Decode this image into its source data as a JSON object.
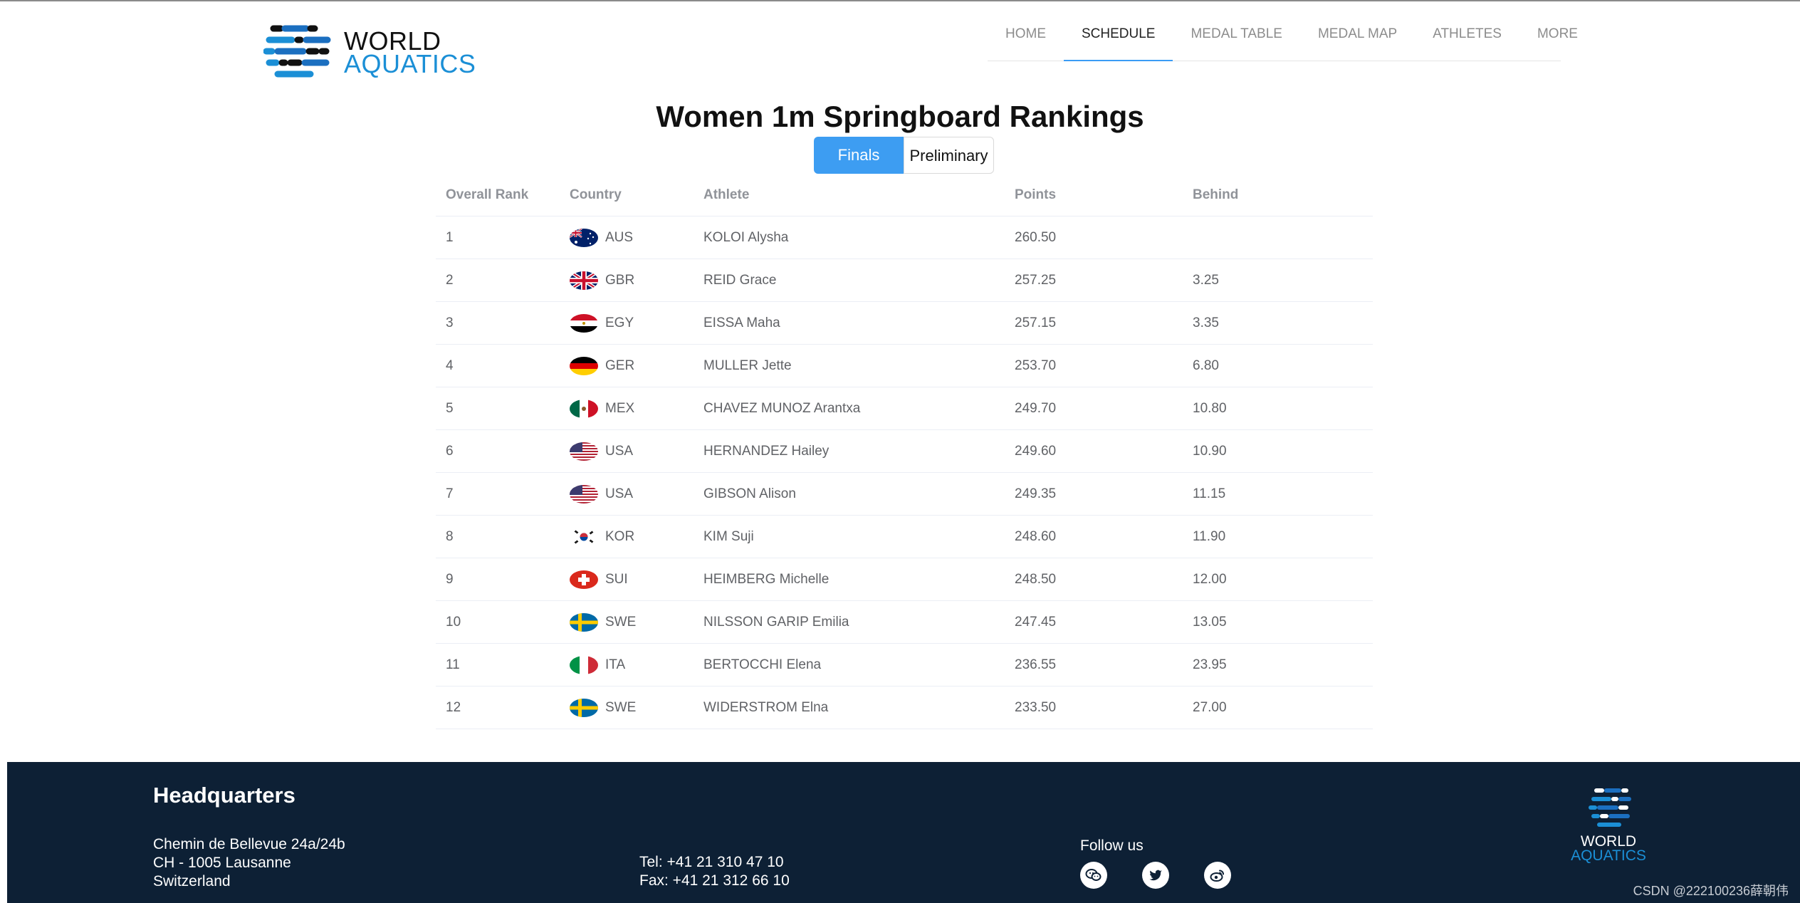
{
  "logo": {
    "line1": "WORLD",
    "line2": "AQUATICS"
  },
  "nav": [
    {
      "label": "HOME"
    },
    {
      "label": "SCHEDULE",
      "active": true
    },
    {
      "label": "MEDAL TABLE"
    },
    {
      "label": "MEDAL MAP"
    },
    {
      "label": "ATHLETES"
    },
    {
      "label": "MORE"
    }
  ],
  "page": {
    "title": "Women 1m Springboard Rankings"
  },
  "tabs": {
    "finals": "Finals",
    "preliminary": "Preliminary",
    "active": "finals"
  },
  "table": {
    "headers": {
      "rank": "Overall Rank",
      "country": "Country",
      "athlete": "Athlete",
      "points": "Points",
      "behind": "Behind"
    },
    "rows": [
      {
        "rank": "1",
        "country": "AUS",
        "athlete": "KOLOI Alysha",
        "points": "260.50",
        "behind": ""
      },
      {
        "rank": "2",
        "country": "GBR",
        "athlete": "REID Grace",
        "points": "257.25",
        "behind": "3.25"
      },
      {
        "rank": "3",
        "country": "EGY",
        "athlete": "EISSA Maha",
        "points": "257.15",
        "behind": "3.35"
      },
      {
        "rank": "4",
        "country": "GER",
        "athlete": "MULLER Jette",
        "points": "253.70",
        "behind": "6.80"
      },
      {
        "rank": "5",
        "country": "MEX",
        "athlete": "CHAVEZ MUNOZ Arantxa",
        "points": "249.70",
        "behind": "10.80"
      },
      {
        "rank": "6",
        "country": "USA",
        "athlete": "HERNANDEZ Hailey",
        "points": "249.60",
        "behind": "10.90"
      },
      {
        "rank": "7",
        "country": "USA",
        "athlete": "GIBSON Alison",
        "points": "249.35",
        "behind": "11.15"
      },
      {
        "rank": "8",
        "country": "KOR",
        "athlete": "KIM Suji",
        "points": "248.60",
        "behind": "11.90"
      },
      {
        "rank": "9",
        "country": "SUI",
        "athlete": "HEIMBERG Michelle",
        "points": "248.50",
        "behind": "12.00"
      },
      {
        "rank": "10",
        "country": "SWE",
        "athlete": "NILSSON GARIP Emilia",
        "points": "247.45",
        "behind": "13.05"
      },
      {
        "rank": "11",
        "country": "ITA",
        "athlete": "BERTOCCHI Elena",
        "points": "236.55",
        "behind": "23.95"
      },
      {
        "rank": "12",
        "country": "SWE",
        "athlete": "WIDERSTROM Elna",
        "points": "233.50",
        "behind": "27.00"
      }
    ]
  },
  "footer": {
    "hq_title": "Headquarters",
    "address": [
      "Chemin de Bellevue 24a/24b",
      "CH - 1005 Lausanne",
      "Switzerland"
    ],
    "tel": "Tel: +41 21 310 47 10",
    "fax": "Fax: +41 21 312 66 10",
    "follow_us": "Follow us",
    "social": [
      "wechat-icon",
      "twitter-icon",
      "weibo-icon"
    ],
    "logo_line1": "WORLD",
    "logo_line2": "AQUATICS"
  },
  "watermark": "CSDN @222100236薛朝伟",
  "colors": {
    "accent": "#3d9df2",
    "footer_bg": "#0d2035",
    "logo_blue": "#1b8fd6",
    "header_text": "#909399",
    "cell_text": "#606266"
  }
}
